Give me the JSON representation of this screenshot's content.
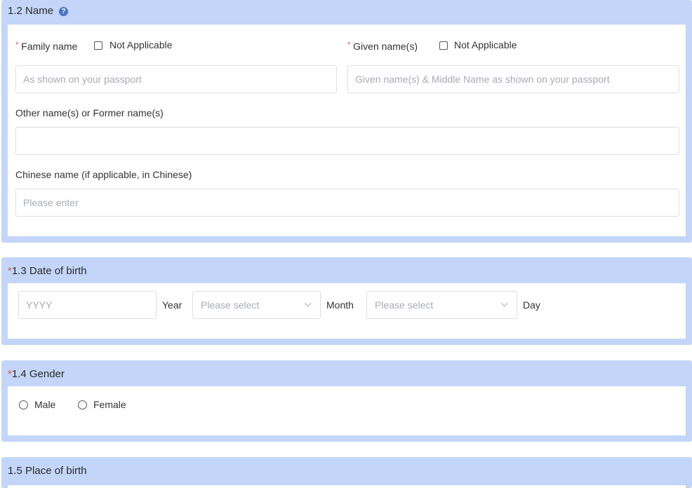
{
  "sections": {
    "name": {
      "title": "1.2 Name",
      "family_name_label": "Family name",
      "family_na_label": "Not Applicable",
      "given_name_label": "Given name(s)",
      "given_na_label": "Not Applicable",
      "family_placeholder": "As shown on your passport",
      "given_placeholder": "Given name(s) & Middle Name as shown on your passport",
      "other_names_label": "Other name(s) or Former name(s)",
      "other_names_value": "",
      "chinese_name_label": "Chinese name (if applicable, in Chinese)",
      "chinese_placeholder": "Please enter"
    },
    "dob": {
      "title": "1.3 Date of birth",
      "year_placeholder": "YYYY",
      "year_label": "Year",
      "month_placeholder": "Please select",
      "month_label": "Month",
      "day_placeholder": "Please select",
      "day_label": "Day"
    },
    "gender": {
      "title": "1.4 Gender",
      "options": [
        "Male",
        "Female"
      ]
    },
    "place_of_birth": {
      "title": "1.5 Place of birth"
    }
  },
  "required_marker": "*",
  "help_icon_glyph": "?",
  "colors": {
    "section_bg": "#c3d5f8",
    "required": "#e9573f",
    "help_icon": "#4a72c9"
  }
}
